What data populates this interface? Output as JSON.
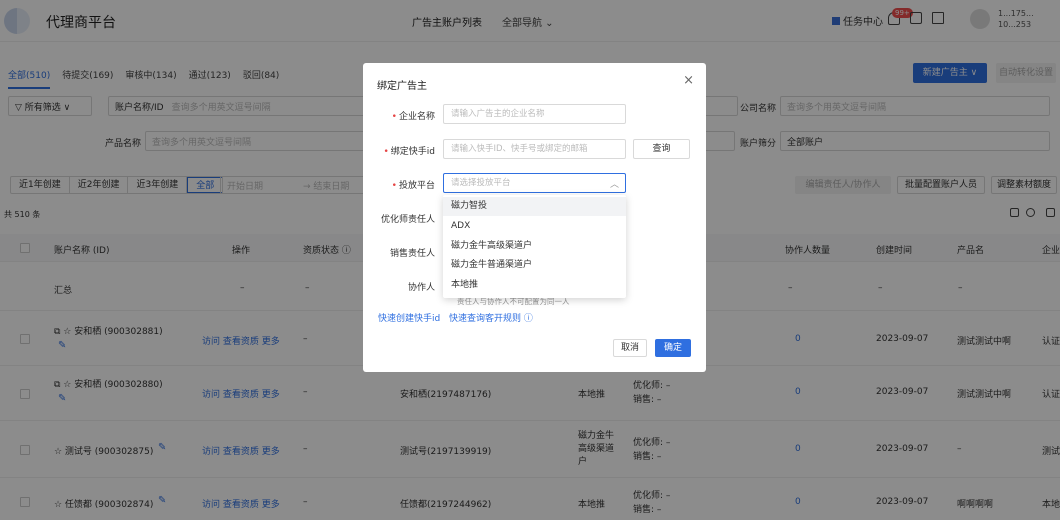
{
  "header": {
    "app_title": "代理商平台",
    "nav": {
      "advertiser_list": "广告主账户列表",
      "all_nav": "全部导航 ⌄"
    },
    "task_center": "任务中心",
    "badge": "99+",
    "account_line1": "1...175...",
    "account_line2": "10...253"
  },
  "tabs": [
    {
      "label": "全部(510)"
    },
    {
      "label": "待提交(169)"
    },
    {
      "label": "审核中(134)"
    },
    {
      "label": "通过(123)"
    },
    {
      "label": "驳回(84)"
    }
  ],
  "toolbar": {
    "new_advertiser": "新建广告主 ∨",
    "auto_transfer": "自动转化设置",
    "edit_owner": "编辑责任人/协作人",
    "batch_config": "批量配置账户人员",
    "adjust_quota": "调整素材额度"
  },
  "filters": {
    "all_filter": "▽ 所有筛选 ∨",
    "account_name_select": "账户名称/ID",
    "multi_query_placeholder": "查询多个用英文逗号间隔",
    "company_label": "公司名称",
    "company_placeholder": "查询多个用英文逗号间隔",
    "product_label": "产品名称",
    "product_placeholder": "查询多个用英文逗号间隔",
    "account_filter_label": "账户筛分",
    "account_filter_value": "全部账户",
    "created_segments": [
      "近1年创建",
      "近2年创建",
      "近3年创建",
      "全部"
    ],
    "start_date": "开始日期",
    "end_date": "→  结束日期"
  },
  "total": "共 510 条",
  "table": {
    "headers": [
      "账户名称 (ID)",
      "操作",
      "资质状态 ⓘ",
      "协作人数量",
      "创建时间",
      "产品名",
      "企业"
    ],
    "summary_label": "汇总",
    "summary_dash": "–",
    "rows": [
      {
        "name": "⧉ ☆ 安和栖 (900302881)",
        "actions": "访问  查看资质  更多",
        "status": "–",
        "owner": "",
        "platform": "",
        "roles": "",
        "count": "0",
        "date": "2023-09-07",
        "product": "测试测试中啊",
        "company": "认证"
      },
      {
        "name": "⧉ ☆ 安和栖 (900302880)",
        "actions": "访问  查看资质  更多",
        "status": "–",
        "owner": "安和栖(2197487176)",
        "platform": "本地推",
        "roles": "优化师: –\n销售: –",
        "count": "0",
        "date": "2023-09-07",
        "product": "测试测试中啊",
        "company": "认证"
      },
      {
        "name": "☆ 测试号 (900302875)",
        "actions": "访问  查看资质  更多",
        "status": "–",
        "owner": "测试号(2197139919)",
        "platform": "磁力金牛\n高级渠道\n户",
        "roles": "优化师: –\n销售: –",
        "count": "0",
        "date": "2023-09-07",
        "product": "–",
        "company": "测试"
      },
      {
        "name": "☆ 任馈都 (900302874)",
        "actions": "访问  查看资质  更多",
        "status": "–",
        "owner": "任馈都(2197244962)",
        "platform": "本地推",
        "roles": "优化师: –\n销售: –",
        "count": "0",
        "date": "2023-09-07",
        "product": "啊啊啊啊",
        "company": "本地"
      }
    ]
  },
  "modal": {
    "title": "绑定广告主",
    "close": "×",
    "company_label": "企业名称",
    "company_placeholder": "请输入广告主的企业名称",
    "kuaishou_label": "绑定快手id",
    "kuaishou_placeholder": "请输入快手ID、快手号或绑定的邮箱",
    "query_button": "查询",
    "platform_label": "投放平台",
    "platform_placeholder": "请选择投放平台",
    "optimizer_label": "优化师责任人",
    "sales_label": "销售责任人",
    "collaborator_label": "协作人",
    "hint": "责任人与协作人不可配置为同一人",
    "quick_create": "快速创建快手id",
    "quick_query": "快速查询客开规则 ⓘ",
    "cancel": "取消",
    "confirm": "确定",
    "platform_options": [
      "磁力智投",
      "ADX",
      "磁力金牛高级渠道户",
      "磁力金牛普通渠道户",
      "本地推"
    ]
  }
}
